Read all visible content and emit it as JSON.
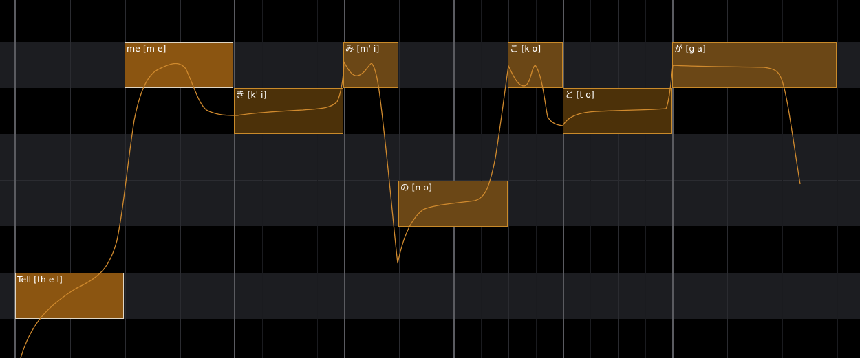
{
  "colors": {
    "background_dark": "#000000",
    "background_light": "#1c1d21",
    "note_fill": "#8b5511",
    "note_border": "#c98a2a",
    "note_selected_border": "#e0d6c4",
    "pitch_curve": "#d08a2e"
  },
  "notes": [
    {
      "label": "Tell [th e l]"
    },
    {
      "label": "me [m e]"
    },
    {
      "label": "き [k' i]"
    },
    {
      "label": "み [m' i]"
    },
    {
      "label": "の [n o]"
    },
    {
      "label": "こ [k o]"
    },
    {
      "label": "と [t o]"
    },
    {
      "label": "が [g a]"
    }
  ]
}
